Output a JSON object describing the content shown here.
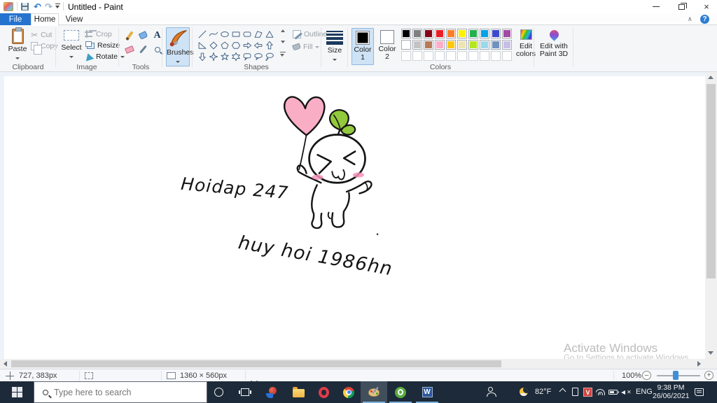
{
  "titlebar": {
    "title": "Untitled - Paint",
    "undo_glyph": "↶",
    "redo_glyph": "↷",
    "close_glyph": "×",
    "help_glyph": "?",
    "collapse_glyph": "∧"
  },
  "tabs": {
    "file": "File",
    "home": "Home",
    "view": "View"
  },
  "ribbon": {
    "clipboard": {
      "group": "Clipboard",
      "paste": "Paste",
      "cut": "Cut",
      "copy": "Copy"
    },
    "image": {
      "group": "Image",
      "select": "Select",
      "crop": "Crop",
      "resize": "Resize",
      "rotate": "Rotate ",
      "text_tool_glyph": "A"
    },
    "tools": {
      "group": "Tools"
    },
    "brushes": {
      "label": "Brushes"
    },
    "shapes": {
      "group": "Shapes",
      "outline": "Outline ",
      "fill": "Fill ",
      "items": [
        "line",
        "curve",
        "ellipse",
        "rectangle",
        "rounded-rectangle",
        "polygon",
        "triangle",
        "right-triangle",
        "diamond",
        "pentagon",
        "hexagon",
        "arrow-right",
        "arrow-left",
        "arrow-up",
        "arrow-down",
        "star-4",
        "star-5",
        "star-6",
        "callout-rounded",
        "callout-oval",
        "callout-cloud"
      ]
    },
    "size": {
      "label": "Size"
    },
    "colors": {
      "group": "Colors",
      "color1_line1": "Color",
      "color1_line2": "1",
      "color2_line1": "Color",
      "color2_line2": "2",
      "color1_value": "#000000",
      "color2_value": "#ffffff",
      "edit_colors_line1": "Edit",
      "edit_colors_line2": "colors",
      "edit_3d_line1": "Edit with",
      "edit_3d_line2": "Paint 3D",
      "palette_row1": [
        "#000000",
        "#7f7f7f",
        "#880015",
        "#ed1c24",
        "#ff7f27",
        "#fff200",
        "#22b14c",
        "#00a2e8",
        "#3f48cc",
        "#a349a4"
      ],
      "palette_row2": [
        "#ffffff",
        "#c3c3c3",
        "#b97a57",
        "#ffaec9",
        "#ffc90e",
        "#efe4b0",
        "#b5e61d",
        "#99d9ea",
        "#7092be",
        "#c8bfe7"
      ],
      "palette_row3_empty": 10
    }
  },
  "canvas": {
    "handwriting_line1": "Hoidap 247",
    "handwriting_line2": "huy hoi 1986hn",
    "heart_color": "#f9aec6",
    "leaf_color": "#93c93c",
    "blush_color": "#f48fb8",
    "ink_color": "#151515"
  },
  "watermark": {
    "line1": "Activate Windows",
    "line2": "Go to Settings to activate Windows."
  },
  "statusbar": {
    "cursor_pos": "727, 383px",
    "canvas_size": "1360 × 560px",
    "zoom": "100%",
    "zoom_minus": "–",
    "zoom_plus": "+"
  },
  "taskbar": {
    "search_placeholder": "Type here to search",
    "language": "ENG",
    "time": "9:38 PM",
    "date": "26/06/2021",
    "weather_temp": "82°F",
    "word_glyph": "W",
    "v_glyph": "V"
  }
}
